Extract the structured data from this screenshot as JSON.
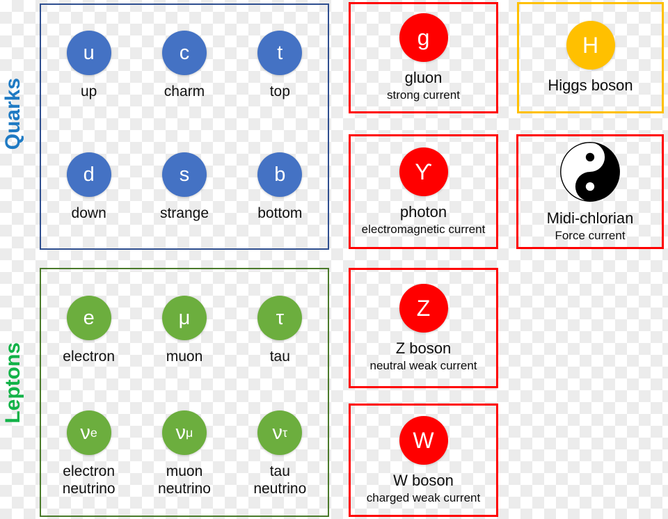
{
  "families": [
    {
      "id": "quarks",
      "label": "Quarks",
      "label_color": "#1F7AC3",
      "border_color": "#2E4E8F",
      "ball_color": "#4472C4",
      "particles": [
        {
          "symbol": "u",
          "name": "up"
        },
        {
          "symbol": "c",
          "name": "charm"
        },
        {
          "symbol": "t",
          "name": "top"
        },
        {
          "symbol": "d",
          "name": "down"
        },
        {
          "symbol": "s",
          "name": "strange"
        },
        {
          "symbol": "b",
          "name": "bottom"
        }
      ]
    },
    {
      "id": "leptons",
      "label": "Leptons",
      "label_color": "#12B248",
      "border_color": "#4A7A2A",
      "ball_color": "#6CAE3E",
      "particles": [
        {
          "symbol": "e",
          "subscript": "",
          "name": "electron"
        },
        {
          "symbol": "μ",
          "subscript": "",
          "name": "muon"
        },
        {
          "symbol": "τ",
          "subscript": "",
          "name": "tau"
        },
        {
          "symbol": "ν",
          "subscript": "e",
          "name": "electron\nneutrino"
        },
        {
          "symbol": "ν",
          "subscript": "μ",
          "name": "muon\nneutrino"
        },
        {
          "symbol": "ν",
          "subscript": "τ",
          "name": "tau\nneutrino"
        }
      ]
    }
  ],
  "bosons": [
    {
      "id": "gluon",
      "symbol": "g",
      "title": "gluon",
      "subtitle": "strong current",
      "ball_color": "#FF0000",
      "border_color": "#FF0000"
    },
    {
      "id": "photon",
      "symbol": "ϒ",
      "title": "photon",
      "subtitle": "electromagnetic current",
      "ball_color": "#FF0000",
      "border_color": "#FF0000"
    },
    {
      "id": "zboson",
      "symbol": "Z",
      "title": "Z boson",
      "subtitle": "neutral weak current",
      "ball_color": "#FF0000",
      "border_color": "#FF0000"
    },
    {
      "id": "wboson",
      "symbol": "W",
      "title": "W boson",
      "subtitle": "charged weak current",
      "ball_color": "#FF0000",
      "border_color": "#FF0000"
    },
    {
      "id": "higgs",
      "symbol": "H",
      "title": "Higgs boson",
      "subtitle": "",
      "ball_color": "#FFC000",
      "border_color": "#FFC000"
    },
    {
      "id": "midichlorian",
      "symbol": "yin-yang-icon",
      "title": "Midi-chlorian",
      "subtitle": "Force current",
      "ball_color": "#000000",
      "border_color": "#FF0000"
    }
  ]
}
